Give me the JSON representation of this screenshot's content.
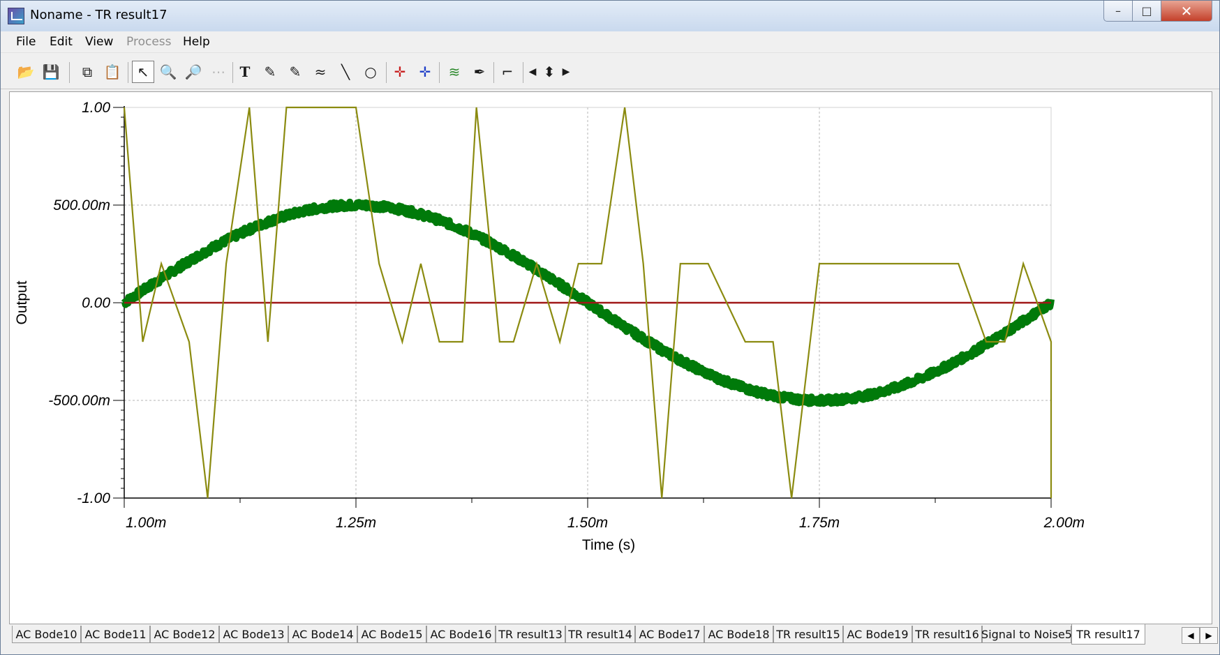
{
  "window": {
    "title": "Noname - TR result17"
  },
  "titlebar_buttons": {
    "minimize": "–",
    "maximize": "□",
    "close": "✕"
  },
  "menu": [
    {
      "label": "File",
      "enabled": true
    },
    {
      "label": "Edit",
      "enabled": true
    },
    {
      "label": "View",
      "enabled": true
    },
    {
      "label": "Process",
      "enabled": false
    },
    {
      "label": "Help",
      "enabled": true
    }
  ],
  "toolbar": [
    {
      "name": "open-icon",
      "glyph": "📂"
    },
    {
      "name": "save-icon",
      "glyph": "💾"
    },
    {
      "name": "copy-icon",
      "glyph": "⧉"
    },
    {
      "name": "paste-icon",
      "glyph": "📋"
    },
    {
      "name": "pointer-icon",
      "glyph": "↖"
    },
    {
      "name": "zoom-in-icon",
      "glyph": "🔍"
    },
    {
      "name": "zoom-100-icon",
      "glyph": "🔎"
    },
    {
      "name": "grid-icon",
      "glyph": "⋯"
    },
    {
      "name": "text-icon",
      "glyph": "T"
    },
    {
      "name": "label-curve-icon",
      "glyph": "✎"
    },
    {
      "name": "label-point-icon",
      "glyph": "✎"
    },
    {
      "name": "label-equation-icon",
      "glyph": "≈"
    },
    {
      "name": "line-icon",
      "glyph": "╲"
    },
    {
      "name": "circle-icon",
      "glyph": "○"
    },
    {
      "name": "cursor-a-icon",
      "glyph": "✛"
    },
    {
      "name": "cursor-b-icon",
      "glyph": "✛"
    },
    {
      "name": "add-curves-icon",
      "glyph": "≋"
    },
    {
      "name": "dropper-icon",
      "glyph": "✒"
    },
    {
      "name": "step-icon",
      "glyph": "⌐"
    },
    {
      "name": "arrow-left-icon",
      "glyph": "◀"
    },
    {
      "name": "arrow-updown-icon",
      "glyph": "⬍"
    },
    {
      "name": "arrow-right-icon",
      "glyph": "▶"
    }
  ],
  "tabs": [
    "AC Bode10",
    "AC Bode11",
    "AC Bode12",
    "AC Bode13",
    "AC Bode14",
    "AC Bode15",
    "AC Bode16",
    "TR result13",
    "TR result14",
    "AC Bode17",
    "AC Bode18",
    "TR result15",
    "AC Bode19",
    "TR result16",
    "Signal to Noise5",
    "TR result17"
  ],
  "active_tab": "TR result17",
  "tab_scroll": {
    "left": "◀",
    "right": "▶"
  },
  "chart_data": {
    "type": "line",
    "xlabel": "Time (s)",
    "ylabel": "Output",
    "xlim": [
      0.001,
      0.002
    ],
    "ylim": [
      -1.0,
      1.0
    ],
    "x_tick_labels": [
      "1.00m",
      "1.25m",
      "1.50m",
      "1.75m",
      "2.00m"
    ],
    "y_tick_labels": [
      "1.00",
      "500.00m",
      "0.00",
      "-500.00m",
      "-1.00"
    ],
    "grid": true,
    "colors": {
      "sine": "#007a0a",
      "zero": "#a01818",
      "digital": "#8b8b10"
    },
    "series": [
      {
        "kind": "noisy_sine",
        "amplitude": 0.5,
        "period": 0.001,
        "x": [
          0.001,
          0.002
        ]
      },
      {
        "kind": "constant",
        "x": [
          0.001,
          0.002
        ],
        "values": [
          0.0,
          0.0
        ]
      },
      {
        "kind": "stepped",
        "x": [
          0.001,
          0.00102,
          0.00104,
          0.00107,
          0.00109,
          0.00111,
          0.001135,
          0.001155,
          0.001175,
          0.00125,
          0.001275,
          0.0013,
          0.00132,
          0.00134,
          0.001365,
          0.00138,
          0.001405,
          0.00142,
          0.001445,
          0.00147,
          0.00149,
          0.001515,
          0.00154,
          0.00156,
          0.00158,
          0.0016,
          0.00163,
          0.00167,
          0.0017,
          0.00172,
          0.00175,
          0.0019,
          0.00193,
          0.00195,
          0.00197,
          0.002,
          0.002
        ],
        "values": [
          1.0,
          -0.2,
          0.2,
          -0.2,
          -1.0,
          0.2,
          1.0,
          -0.2,
          1.0,
          1.0,
          0.2,
          -0.2,
          0.2,
          -0.2,
          -0.2,
          1.0,
          -0.2,
          -0.2,
          0.2,
          -0.2,
          0.2,
          0.2,
          1.0,
          0.2,
          -1.0,
          0.2,
          0.2,
          -0.2,
          -0.2,
          -1.0,
          0.2,
          0.2,
          -0.2,
          -0.2,
          0.2,
          -0.2,
          -1.0
        ]
      }
    ]
  }
}
